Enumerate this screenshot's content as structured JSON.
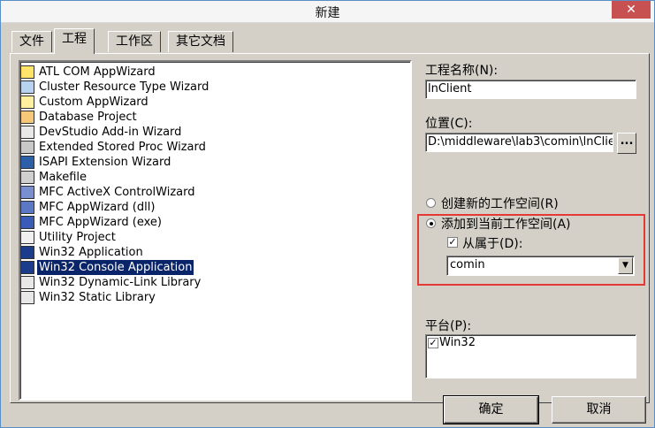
{
  "window": {
    "title": "新建",
    "close_glyph": "✕"
  },
  "tabs": [
    {
      "label": "文件"
    },
    {
      "label": "工程"
    },
    {
      "label": "工作区"
    },
    {
      "label": "其它文档"
    }
  ],
  "project_types": [
    {
      "label": "ATL COM AppWizard",
      "icon": "atl-com-icon"
    },
    {
      "label": "Cluster Resource Type Wizard",
      "icon": "cluster-icon"
    },
    {
      "label": "Custom AppWizard",
      "icon": "custom-wizard-icon"
    },
    {
      "label": "Database Project",
      "icon": "database-icon"
    },
    {
      "label": "DevStudio Add-in Wizard",
      "icon": "addin-icon"
    },
    {
      "label": "Extended Stored Proc Wizard",
      "icon": "stored-proc-icon"
    },
    {
      "label": "ISAPI Extension Wizard",
      "icon": "isapi-icon"
    },
    {
      "label": "Makefile",
      "icon": "makefile-icon"
    },
    {
      "label": "MFC ActiveX ControlWizard",
      "icon": "activex-icon"
    },
    {
      "label": "MFC AppWizard (dll)",
      "icon": "mfc-dll-icon"
    },
    {
      "label": "MFC AppWizard (exe)",
      "icon": "mfc-exe-icon"
    },
    {
      "label": "Utility Project",
      "icon": "utility-icon"
    },
    {
      "label": "Win32 Application",
      "icon": "win32-app-icon"
    },
    {
      "label": "Win32 Console Application",
      "icon": "console-icon",
      "selected": true
    },
    {
      "label": "Win32 Dynamic-Link Library",
      "icon": "dll-icon"
    },
    {
      "label": "Win32 Static Library",
      "icon": "lib-icon"
    }
  ],
  "project_name": {
    "label": "工程名称(N):",
    "value": "lnClient"
  },
  "location": {
    "label": "位置(C):",
    "value": "D:\\middleware\\lab3\\comin\\lnClie",
    "browse_label": "..."
  },
  "workspace": {
    "create_new_label": "创建新的工作空间(R)",
    "add_to_current_label": "添加到当前工作空间(A)",
    "dependency_label": "从属于(D):",
    "dependency_value": "comin",
    "dropdown_arrow": "▼",
    "selected_option": "add_to_current",
    "dependency_checked": true
  },
  "platform": {
    "label": "平台(P):",
    "item": "Win32",
    "checked": true
  },
  "buttons": {
    "ok": "确定",
    "cancel": "取消"
  },
  "colors": {
    "selection": "#0a246a",
    "highlight_border": "#e53935",
    "close_button": "#c75050"
  }
}
